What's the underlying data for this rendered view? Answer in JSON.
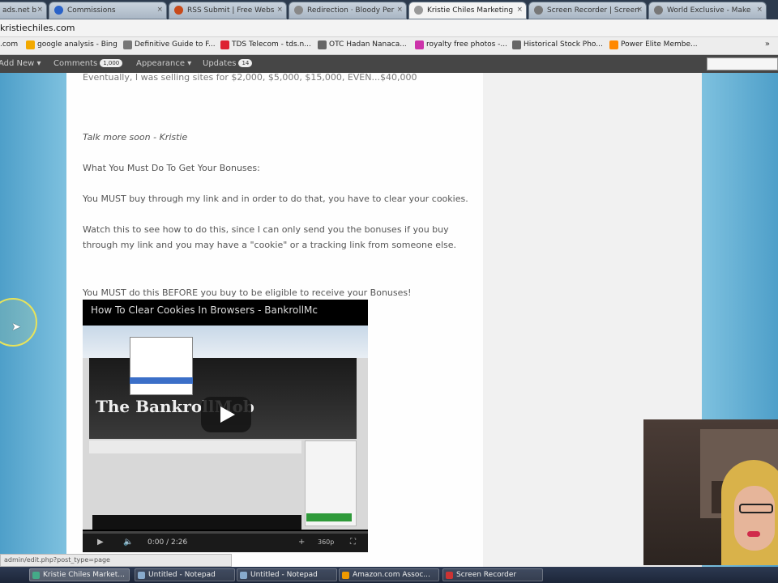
{
  "browser": {
    "tabs": [
      {
        "label": "ads.net b",
        "icon": "document-icon",
        "color": "#8aa"
      },
      {
        "label": "Commissions",
        "icon": "circle-icon",
        "color": "#2a62c8"
      },
      {
        "label": "RSS Submit | Free Webs",
        "icon": "rss-icon",
        "color": "#c84a1a"
      },
      {
        "label": "Redirection · Bloody Per",
        "icon": "redirect-icon",
        "color": "#888"
      },
      {
        "label": "Kristie Chiles Marketing",
        "icon": "page-icon",
        "color": "#999"
      },
      {
        "label": "Screen Recorder | Screen",
        "icon": "recorder-icon",
        "color": "#777"
      },
      {
        "label": "World Exclusive - Make",
        "icon": "globe-icon",
        "color": "#777"
      }
    ],
    "url": "kristiechiles.com",
    "bookmarks": [
      {
        "label": ".com",
        "color": "#aaa"
      },
      {
        "label": "google analysis - Bing",
        "color": "#f2a900"
      },
      {
        "label": "Definitive Guide to F...",
        "color": "#777"
      },
      {
        "label": "TDS Telecom - tds.n...",
        "color": "#d23"
      },
      {
        "label": "OTC Hadan Nanaca...",
        "color": "#666"
      },
      {
        "label": "royalty free photos -...",
        "color": "#c3a"
      },
      {
        "label": "Historical Stock Pho...",
        "color": "#666"
      },
      {
        "label": "Power Elite Membe...",
        "color": "#f80"
      }
    ],
    "bookmarks_more": "»"
  },
  "adminbar": {
    "add_new": "Add New ▾",
    "comments": "Comments",
    "comments_count": "1,000",
    "appearance": "Appearance ▾",
    "updates": "Updates",
    "updates_count": "14"
  },
  "post": {
    "cut_line": "Eventually, I was selling sites for $2,000, $5,000, $15,000, EVEN...$40,000",
    "signoff": "Talk more soon - Kristie",
    "heading": "What You Must Do To Get Your Bonuses:",
    "para1": "You MUST buy through my link and in order to do that, you have to clear your cookies.",
    "para2": "Watch this to see how to do this, since I can only send you the bonuses if you buy through my link and you may have a \"cookie\" or a tracking link from someone else.",
    "para3": "You MUST do this BEFORE you buy to be eligible to receive your Bonuses!"
  },
  "video": {
    "title": "How To Clear Cookies In Browsers - BankrollMc",
    "logo_text": "The BankrollMob",
    "time": "0:00 / 2:26",
    "progress": 0,
    "hd_label": "360p"
  },
  "status_url": "admin/edit.php?post_type=page",
  "taskbar": [
    {
      "label": "Kristie Chiles Market...",
      "color": "#4a8"
    },
    {
      "label": "Untitled - Notepad",
      "color": "#8ac"
    },
    {
      "label": "Untitled - Notepad",
      "color": "#8ac"
    },
    {
      "label": "Amazon.com Assoc...",
      "color": "#e90"
    },
    {
      "label": "Screen Recorder",
      "color": "#c33"
    }
  ]
}
